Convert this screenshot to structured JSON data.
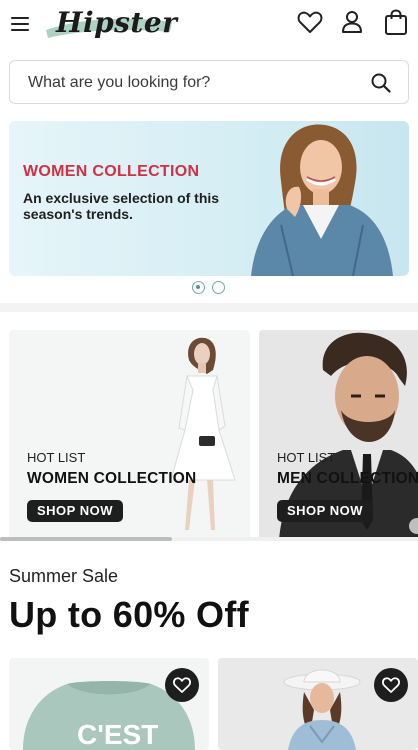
{
  "header": {
    "logo_text": "Hipster",
    "icons": [
      "menu-icon",
      "wishlist-heart-icon",
      "account-user-icon",
      "cart-bag-icon"
    ]
  },
  "search": {
    "placeholder": "What are you looking for?"
  },
  "hero": {
    "title": "WOMEN COLLECTION",
    "subtitle": "An exclusive selection of this season's trends.",
    "slide_count": 2,
    "active_slide": 1
  },
  "collections": [
    {
      "kicker": "HOT LIST",
      "title": "WOMEN COLLECTION",
      "button": "SHOP NOW"
    },
    {
      "kicker": "HOT LIST",
      "title": "MEN COLLECTION",
      "button": "SHOP NOW"
    }
  ],
  "sale": {
    "kicker": "Summer Sale",
    "title": "Up to 60% Off"
  },
  "products": [
    {
      "shirt_text": "C'EST"
    },
    {
      "shirt_text": ""
    }
  ],
  "colors": {
    "accent_red": "#d13045",
    "dark": "#1e1e1e",
    "dot_active": "#5b8f8a",
    "hero_bg": "#d5eef4"
  }
}
